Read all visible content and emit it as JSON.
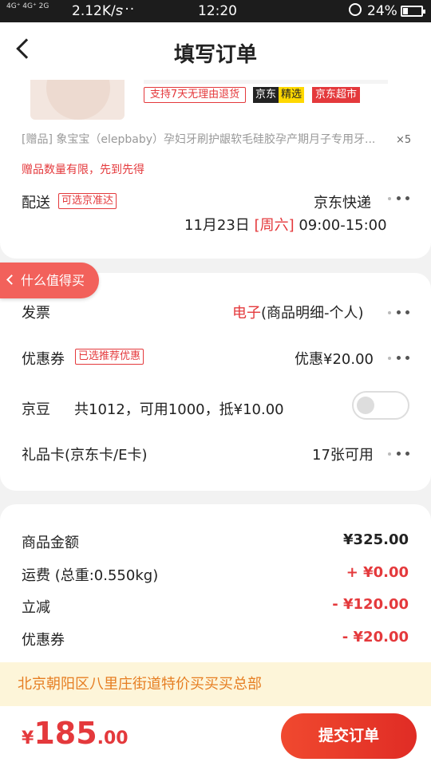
{
  "status_bar": {
    "network": "4G⁺ 4G⁺ 2G",
    "speed": "2.12K/s",
    "more": "···",
    "time": "12:20",
    "battery": "24%"
  },
  "header": {
    "title": "填写订单"
  },
  "product": {
    "tags": {
      "return_policy": "支持7天无理由退货",
      "jd": "京东",
      "selected": "精选",
      "supermarket": "京东超市"
    },
    "gift_line": "[赠品]   象宝宝（elepbaby）孕妇牙刷护龈软毛硅胶孕产期月子专用牙...",
    "gift_qty": "×5",
    "gift_limit_note": "赠品数量有限，先到先得"
  },
  "delivery": {
    "label": "配送",
    "badge": "可选京准达",
    "company": "京东快递",
    "date": "11月23日",
    "weekday": "[周六]",
    "time_range": "09:00-15:00"
  },
  "floating_tab": {
    "label": "什么值得买"
  },
  "invoice": {
    "label": "发票",
    "type": "电子",
    "detail": "(商品明细-个人)"
  },
  "coupon": {
    "label": "优惠券",
    "badge": "已选推荐优惠",
    "value": "优惠¥20.00"
  },
  "jingdou": {
    "label": "京豆",
    "text": "共1012，可用1000，抵¥10.00",
    "enabled": false
  },
  "gift_card": {
    "label": "礼品卡(京东卡/E卡)",
    "value": "17张可用"
  },
  "summary": [
    {
      "label": "商品金额",
      "value": "¥325.00",
      "highlight": false
    },
    {
      "label": "运费  (总重:0.550kg)",
      "value": "+ ¥0.00",
      "highlight": true
    },
    {
      "label": "立减",
      "value": "- ¥120.00",
      "highlight": true
    },
    {
      "label": "优惠券",
      "value": "- ¥20.00",
      "highlight": true
    }
  ],
  "address_banner": "北京朝阳区八里庄街道特价买买买总部",
  "footer": {
    "currency": "¥",
    "total_int": "185",
    "total_dec": ".00",
    "submit_label": "提交订单"
  },
  "colors": {
    "accent": "#e4393c",
    "banner_bg": "#fdf5d9",
    "banner_text": "#e67e22"
  }
}
